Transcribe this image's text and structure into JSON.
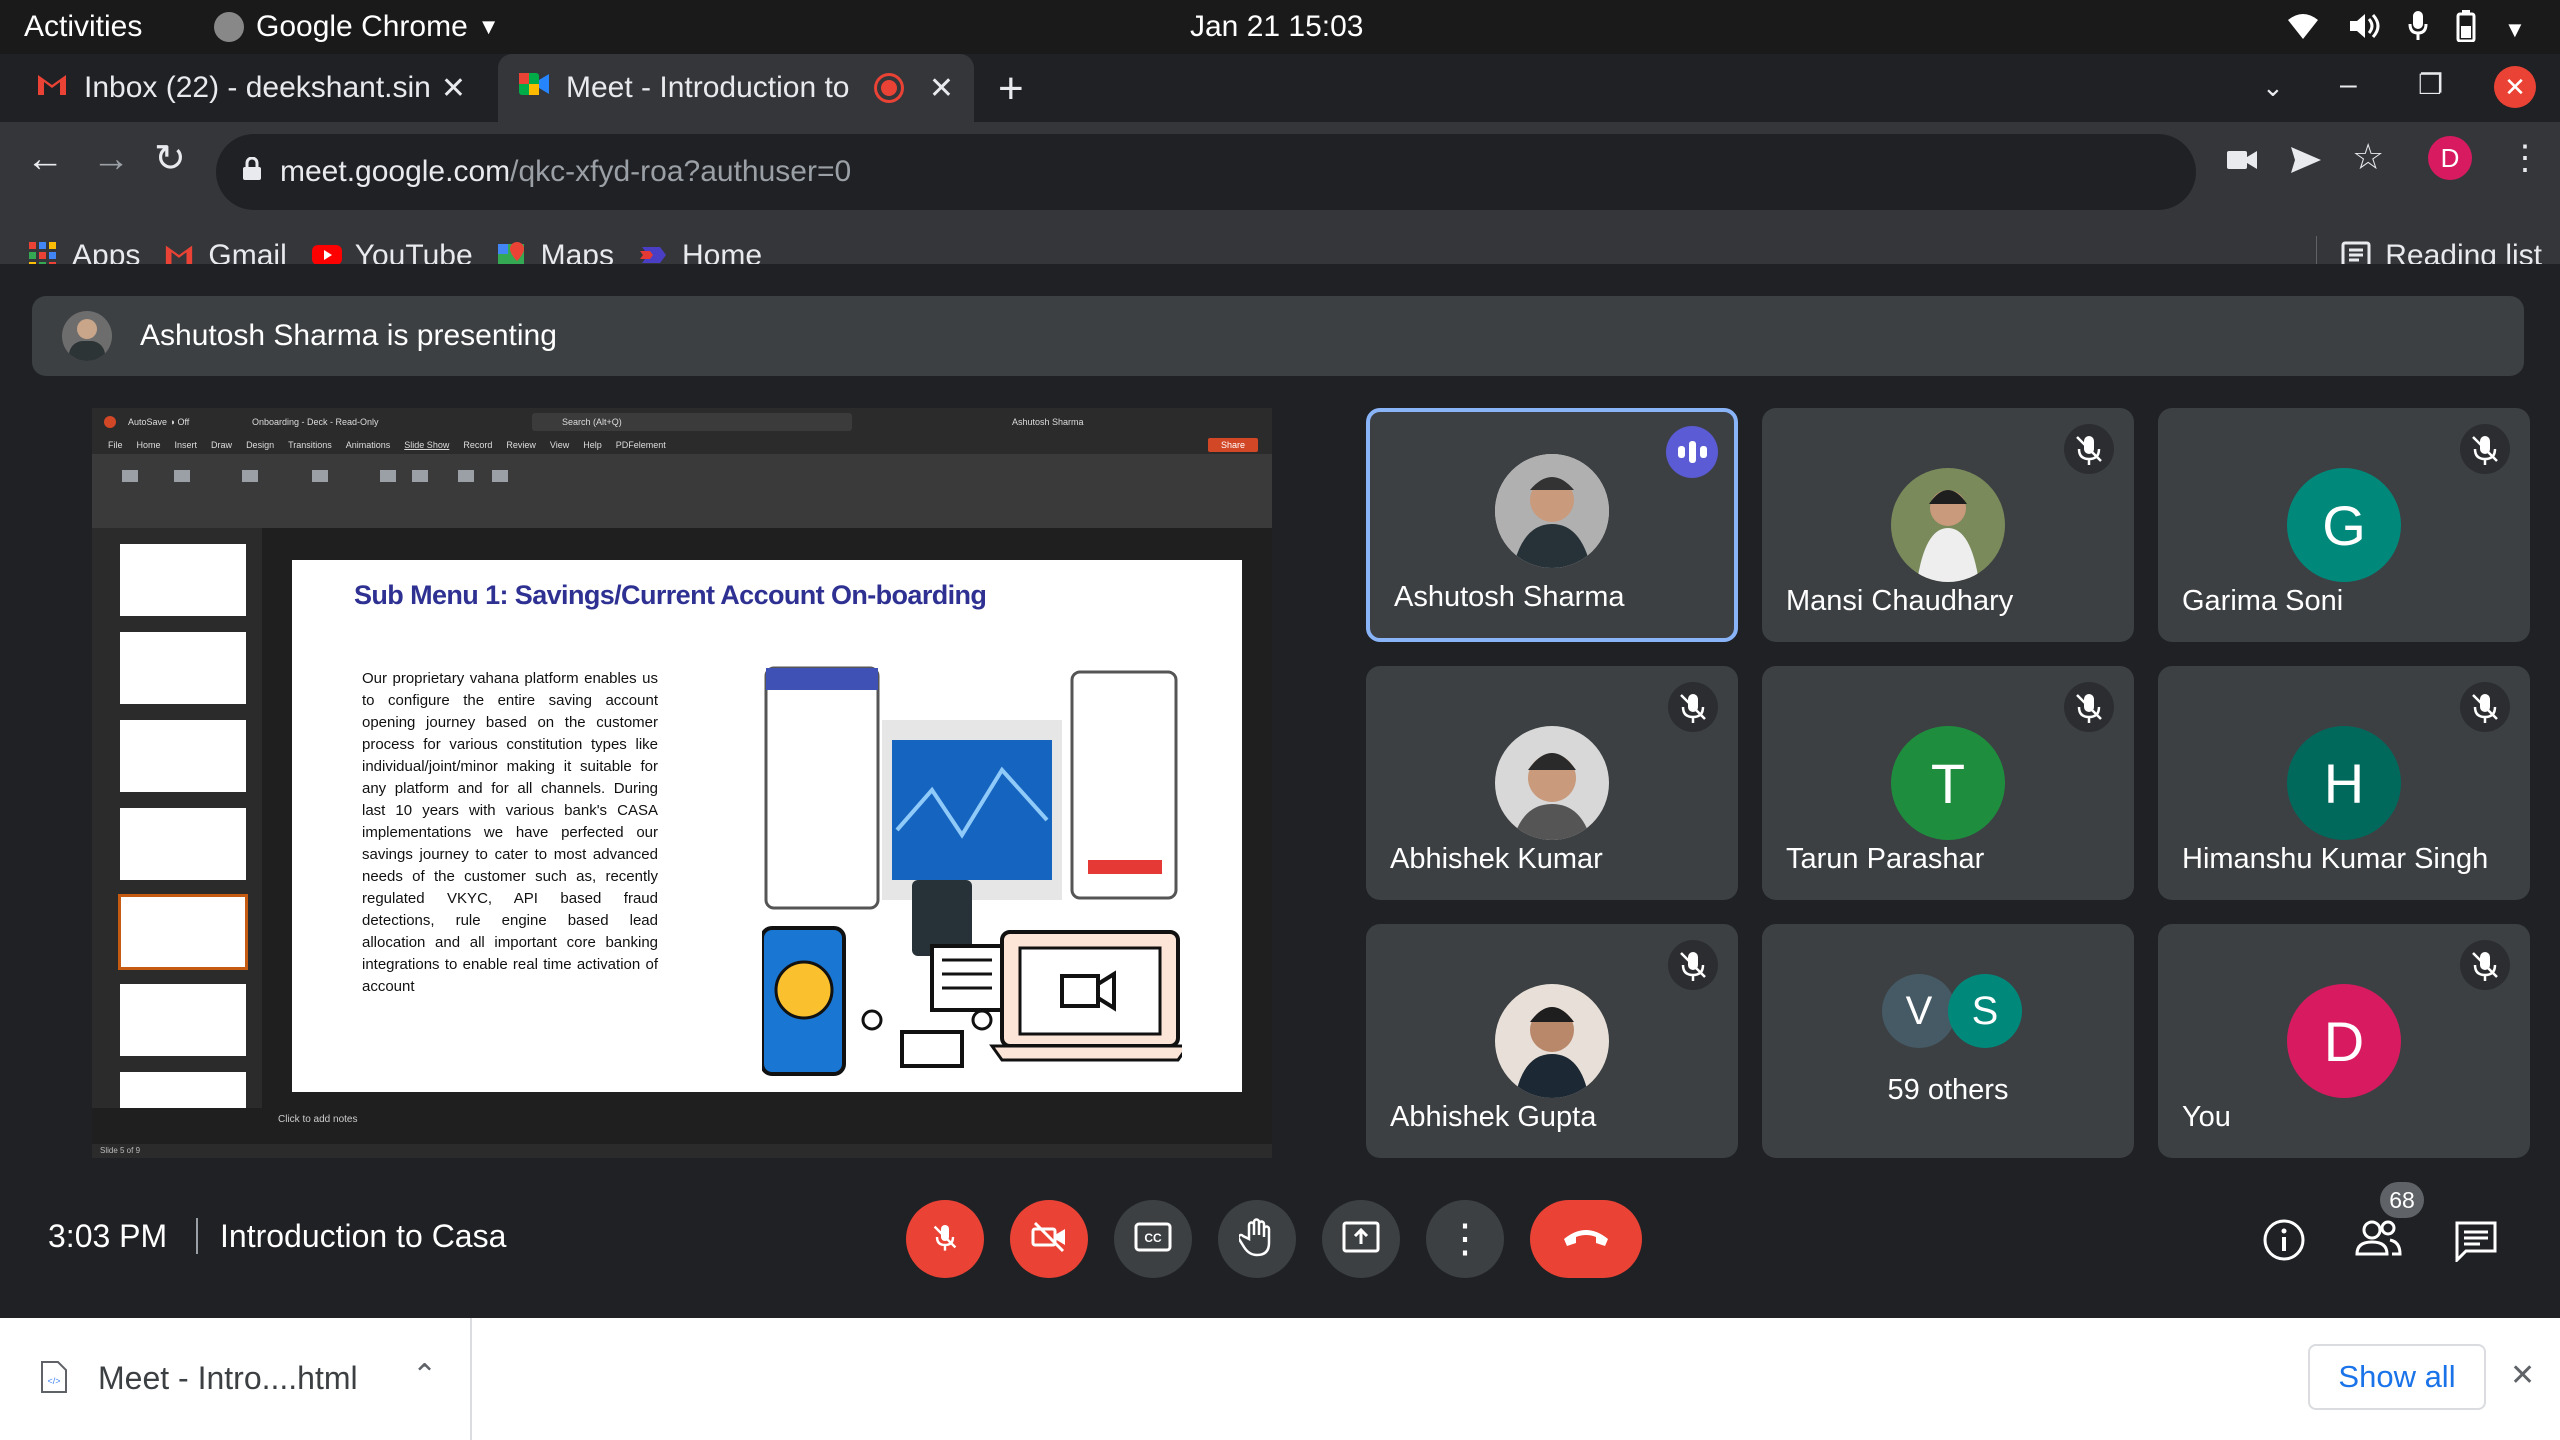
{
  "topbar": {
    "activities": "Activities",
    "app": "Google Chrome",
    "datetime": "Jan 21  15:03"
  },
  "tabs": [
    {
      "title": "Inbox (22) - deekshant.sin"
    },
    {
      "title": "Meet - Introduction to"
    }
  ],
  "address": {
    "domain": "meet.google.com",
    "path": "/qkc-xfyd-roa?authuser=0"
  },
  "profile_letter": "D",
  "bookmarks": [
    {
      "label": "Apps",
      "icon": "apps-grid-icon"
    },
    {
      "label": "Gmail",
      "icon": "gmail-icon"
    },
    {
      "label": "YouTube",
      "icon": "youtube-icon"
    },
    {
      "label": "Maps",
      "icon": "maps-icon"
    },
    {
      "label": "Home",
      "icon": "home-icon"
    }
  ],
  "reading_list": "Reading list",
  "presenting": "Ashutosh Sharma is presenting",
  "slide": {
    "title": "Sub Menu 1: Savings/Current Account On-boarding",
    "body": "Our proprietary vahana platform enables us to configure the entire saving account opening journey based on the customer process for various constitution types like individual/joint/minor making it suitable for any platform and for all channels. During last 10 years with various bank's CASA implementations we have perfected our savings journey to cater to most advanced needs of the customer such as, recently regulated VKYC, API based fraud detections, rule engine based lead allocation and all important core banking integrations to enable real time activation of account",
    "notes": "Click to add notes",
    "status": "Slide 5 of 9",
    "share": "Share",
    "ribbon_tabs": [
      "File",
      "Home",
      "Insert",
      "Draw",
      "Design",
      "Transitions",
      "Animations",
      "Slide Show",
      "Record",
      "Review",
      "View",
      "Help",
      "PDFelement"
    ],
    "doc": "Onboarding - Deck  -  Read-Only",
    "search": "Search (Alt+Q)",
    "user": "Ashutosh Sharma"
  },
  "participants": [
    {
      "name": "Ashutosh Sharma",
      "type": "photo",
      "speaking": true
    },
    {
      "name": "Mansi Chaudhary",
      "type": "photo"
    },
    {
      "name": "Garima Soni",
      "letter": "G",
      "color": "#00897b"
    },
    {
      "name": "Abhishek Kumar",
      "type": "photo"
    },
    {
      "name": "Tarun Parashar",
      "letter": "T",
      "color": "#1e8e3e"
    },
    {
      "name": "Himanshu Kumar Singh",
      "letter": "H",
      "color": "#00695c"
    },
    {
      "name": "Abhishek Gupta",
      "type": "photo"
    },
    {
      "name": "59 others",
      "letters": [
        "V",
        "S"
      ]
    },
    {
      "name": "You",
      "letter": "D",
      "color": "#d81b60"
    }
  ],
  "meeting": {
    "time": "3:03 PM",
    "title": "Introduction to Casa",
    "people_count": "68"
  },
  "download": {
    "file": "Meet - Intro....html",
    "show_all": "Show all"
  },
  "colors": {
    "red": "#ea4335",
    "blue": "#8ab4f8",
    "tile": "#3c4043"
  }
}
